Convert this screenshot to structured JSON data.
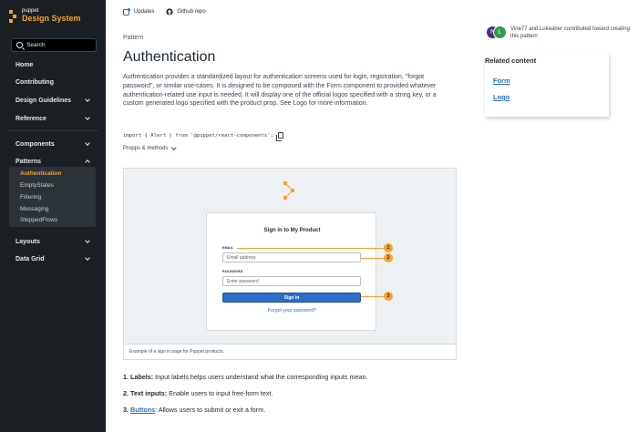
{
  "sidebar": {
    "brand_small": "puppet",
    "brand_name": "Design System",
    "search_label": "Search",
    "items": [
      {
        "label": "Home"
      },
      {
        "label": "Contributing"
      },
      {
        "label": "Design Guidelines"
      },
      {
        "label": "Reference"
      },
      {
        "label": "Components"
      },
      {
        "label": "Patterns"
      },
      {
        "label": "Layouts"
      },
      {
        "label": "Data Grid"
      }
    ],
    "pattern_items": [
      {
        "label": "Authentication",
        "active": true
      },
      {
        "label": "EmptyStates"
      },
      {
        "label": "Filtering"
      },
      {
        "label": "Messaging"
      },
      {
        "label": "SteppedFlows"
      }
    ]
  },
  "topbar": {
    "updates_label": "Updates",
    "github_label": "Github repo"
  },
  "main": {
    "eyebrow": "Pattern",
    "title": "Authentication",
    "description": "Authentication provides a standardized layout for authentication screens used for login, registration, \"forgot password\", or similar use-cases. It is designed to be composed with the Form component to provided whatever authentication-related use input is needed. It will display one of the official logos specified with a string key, or a custom generated logo specified with the product prop. See Logo for more information.",
    "code": "import { Alert } from '@puppet/react-components';",
    "props_toggle": "Propps & methods"
  },
  "example": {
    "card_title": "Sign in to My Product",
    "email_label": "EMAIL",
    "email_placeholder": "Email address",
    "password_label": "PASSWORD",
    "password_placeholder": "Enter password",
    "signin_label": "Sign in",
    "forgot_label": "Forgot your password?",
    "callouts": [
      "1",
      "2",
      "3"
    ],
    "caption": "Example of a sign in page for Puppet products."
  },
  "explanations": [
    {
      "lead": "1. Labels:",
      "text": " Input labels helps users understand what the corresponding inputs mean."
    },
    {
      "lead": "2. Text inputs:",
      "text": " Enable users to input free-form text."
    },
    {
      "lead": "3. ",
      "link": "Buttons",
      "text": ": Allows users to submit or exit a form."
    }
  ],
  "contributors": {
    "avatars": [
      {
        "initial": "N",
        "color": "#4a2a8a"
      },
      {
        "initial": "L",
        "color": "#2f9a4a"
      }
    ],
    "text": "Vine77 and Lukeaber contributed toward creating this pattern"
  },
  "related": {
    "title": "Related content",
    "links": [
      "Form",
      "Logo"
    ]
  },
  "colors": {
    "sidebar_bg": "#1b2024",
    "accent": "#f8a22b",
    "link": "#2b6fc9"
  }
}
